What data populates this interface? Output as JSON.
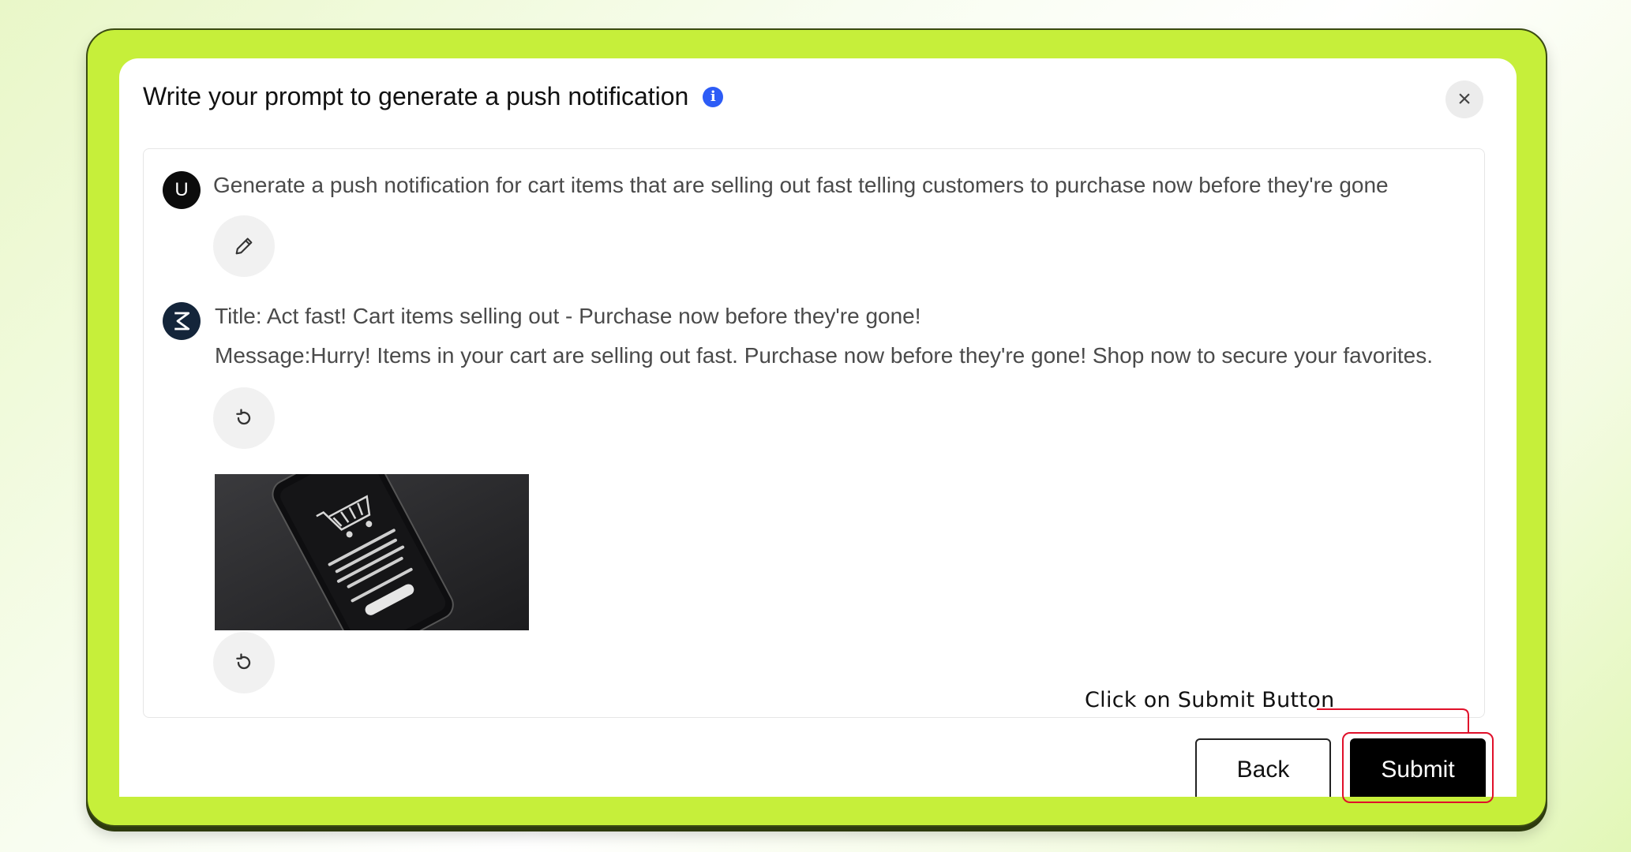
{
  "modal": {
    "title": "Write your prompt to generate a push notification",
    "info_icon": "info-icon",
    "close_icon": "close-icon"
  },
  "conversation": {
    "user_avatar_letter": "U",
    "user_message": "Generate a push notification for cart items that are selling out fast telling customers to purchase now before they're gone",
    "bot_title": "Title:  Act fast! Cart items selling out - Purchase now before they're gone!",
    "bot_message": "Message:Hurry! Items in your cart are selling out fast. Purchase now before they're gone! Shop now to secure your favorites.",
    "edit_icon": "pencil-icon",
    "regenerate_icon": "refresh-icon",
    "image_description_icon": "shopping-cart-phone-image"
  },
  "footer": {
    "back_label": "Back",
    "submit_label": "Submit"
  },
  "annotation": {
    "label": "Click on Submit Button",
    "color": "#e0102a"
  },
  "colors": {
    "frame_green": "#c6ef3a",
    "info_blue": "#2d5cf6",
    "submit_bg": "#000000"
  }
}
